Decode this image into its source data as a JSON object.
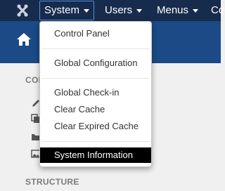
{
  "colors": {
    "topbar": "#172b4d",
    "subheader": "#1b4a86",
    "highlight": "#000000",
    "nav_focus_border": "#4f8fe0"
  },
  "topbar": {
    "logo_icon": "joomla-logo-icon",
    "nav": [
      {
        "label": "System"
      },
      {
        "label": "Users"
      },
      {
        "label": "Menus"
      },
      {
        "label": "Co"
      }
    ]
  },
  "subheader": {
    "home_icon": "home-icon"
  },
  "sidebar": {
    "section_title": "CONT",
    "section2_title": "STRUCTURE",
    "icons": [
      "edit-icon",
      "copy-icon",
      "folder-icon",
      "image-icon"
    ]
  },
  "dropdown": {
    "items": [
      {
        "label": "Control Panel"
      },
      {
        "label": "Global Configuration"
      },
      {
        "label": "Global Check-in"
      },
      {
        "label": "Clear Cache"
      },
      {
        "label": "Clear Expired Cache"
      },
      {
        "label": "System Information",
        "active": true
      }
    ]
  }
}
